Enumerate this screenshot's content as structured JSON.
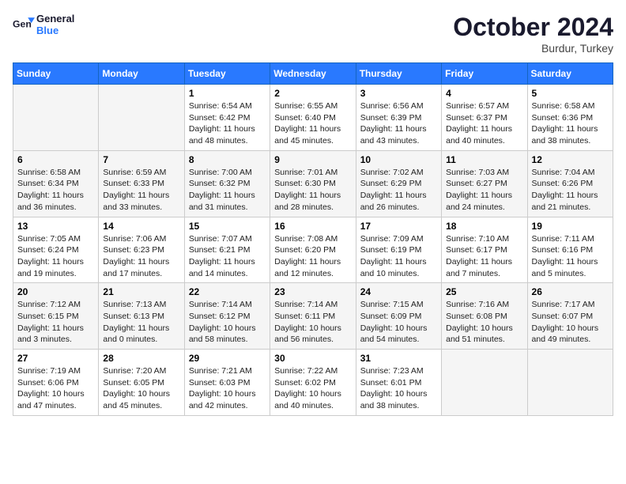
{
  "logo": {
    "general": "General",
    "blue": "Blue"
  },
  "title": {
    "month_year": "October 2024",
    "location": "Burdur, Turkey"
  },
  "headers": [
    "Sunday",
    "Monday",
    "Tuesday",
    "Wednesday",
    "Thursday",
    "Friday",
    "Saturday"
  ],
  "weeks": [
    [
      {
        "day": "",
        "detail": ""
      },
      {
        "day": "",
        "detail": ""
      },
      {
        "day": "1",
        "detail": "Sunrise: 6:54 AM\nSunset: 6:42 PM\nDaylight: 11 hours and 48 minutes."
      },
      {
        "day": "2",
        "detail": "Sunrise: 6:55 AM\nSunset: 6:40 PM\nDaylight: 11 hours and 45 minutes."
      },
      {
        "day": "3",
        "detail": "Sunrise: 6:56 AM\nSunset: 6:39 PM\nDaylight: 11 hours and 43 minutes."
      },
      {
        "day": "4",
        "detail": "Sunrise: 6:57 AM\nSunset: 6:37 PM\nDaylight: 11 hours and 40 minutes."
      },
      {
        "day": "5",
        "detail": "Sunrise: 6:58 AM\nSunset: 6:36 PM\nDaylight: 11 hours and 38 minutes."
      }
    ],
    [
      {
        "day": "6",
        "detail": "Sunrise: 6:58 AM\nSunset: 6:34 PM\nDaylight: 11 hours and 36 minutes."
      },
      {
        "day": "7",
        "detail": "Sunrise: 6:59 AM\nSunset: 6:33 PM\nDaylight: 11 hours and 33 minutes."
      },
      {
        "day": "8",
        "detail": "Sunrise: 7:00 AM\nSunset: 6:32 PM\nDaylight: 11 hours and 31 minutes."
      },
      {
        "day": "9",
        "detail": "Sunrise: 7:01 AM\nSunset: 6:30 PM\nDaylight: 11 hours and 28 minutes."
      },
      {
        "day": "10",
        "detail": "Sunrise: 7:02 AM\nSunset: 6:29 PM\nDaylight: 11 hours and 26 minutes."
      },
      {
        "day": "11",
        "detail": "Sunrise: 7:03 AM\nSunset: 6:27 PM\nDaylight: 11 hours and 24 minutes."
      },
      {
        "day": "12",
        "detail": "Sunrise: 7:04 AM\nSunset: 6:26 PM\nDaylight: 11 hours and 21 minutes."
      }
    ],
    [
      {
        "day": "13",
        "detail": "Sunrise: 7:05 AM\nSunset: 6:24 PM\nDaylight: 11 hours and 19 minutes."
      },
      {
        "day": "14",
        "detail": "Sunrise: 7:06 AM\nSunset: 6:23 PM\nDaylight: 11 hours and 17 minutes."
      },
      {
        "day": "15",
        "detail": "Sunrise: 7:07 AM\nSunset: 6:21 PM\nDaylight: 11 hours and 14 minutes."
      },
      {
        "day": "16",
        "detail": "Sunrise: 7:08 AM\nSunset: 6:20 PM\nDaylight: 11 hours and 12 minutes."
      },
      {
        "day": "17",
        "detail": "Sunrise: 7:09 AM\nSunset: 6:19 PM\nDaylight: 11 hours and 10 minutes."
      },
      {
        "day": "18",
        "detail": "Sunrise: 7:10 AM\nSunset: 6:17 PM\nDaylight: 11 hours and 7 minutes."
      },
      {
        "day": "19",
        "detail": "Sunrise: 7:11 AM\nSunset: 6:16 PM\nDaylight: 11 hours and 5 minutes."
      }
    ],
    [
      {
        "day": "20",
        "detail": "Sunrise: 7:12 AM\nSunset: 6:15 PM\nDaylight: 11 hours and 3 minutes."
      },
      {
        "day": "21",
        "detail": "Sunrise: 7:13 AM\nSunset: 6:13 PM\nDaylight: 11 hours and 0 minutes."
      },
      {
        "day": "22",
        "detail": "Sunrise: 7:14 AM\nSunset: 6:12 PM\nDaylight: 10 hours and 58 minutes."
      },
      {
        "day": "23",
        "detail": "Sunrise: 7:14 AM\nSunset: 6:11 PM\nDaylight: 10 hours and 56 minutes."
      },
      {
        "day": "24",
        "detail": "Sunrise: 7:15 AM\nSunset: 6:09 PM\nDaylight: 10 hours and 54 minutes."
      },
      {
        "day": "25",
        "detail": "Sunrise: 7:16 AM\nSunset: 6:08 PM\nDaylight: 10 hours and 51 minutes."
      },
      {
        "day": "26",
        "detail": "Sunrise: 7:17 AM\nSunset: 6:07 PM\nDaylight: 10 hours and 49 minutes."
      }
    ],
    [
      {
        "day": "27",
        "detail": "Sunrise: 7:19 AM\nSunset: 6:06 PM\nDaylight: 10 hours and 47 minutes."
      },
      {
        "day": "28",
        "detail": "Sunrise: 7:20 AM\nSunset: 6:05 PM\nDaylight: 10 hours and 45 minutes."
      },
      {
        "day": "29",
        "detail": "Sunrise: 7:21 AM\nSunset: 6:03 PM\nDaylight: 10 hours and 42 minutes."
      },
      {
        "day": "30",
        "detail": "Sunrise: 7:22 AM\nSunset: 6:02 PM\nDaylight: 10 hours and 40 minutes."
      },
      {
        "day": "31",
        "detail": "Sunrise: 7:23 AM\nSunset: 6:01 PM\nDaylight: 10 hours and 38 minutes."
      },
      {
        "day": "",
        "detail": ""
      },
      {
        "day": "",
        "detail": ""
      }
    ]
  ]
}
